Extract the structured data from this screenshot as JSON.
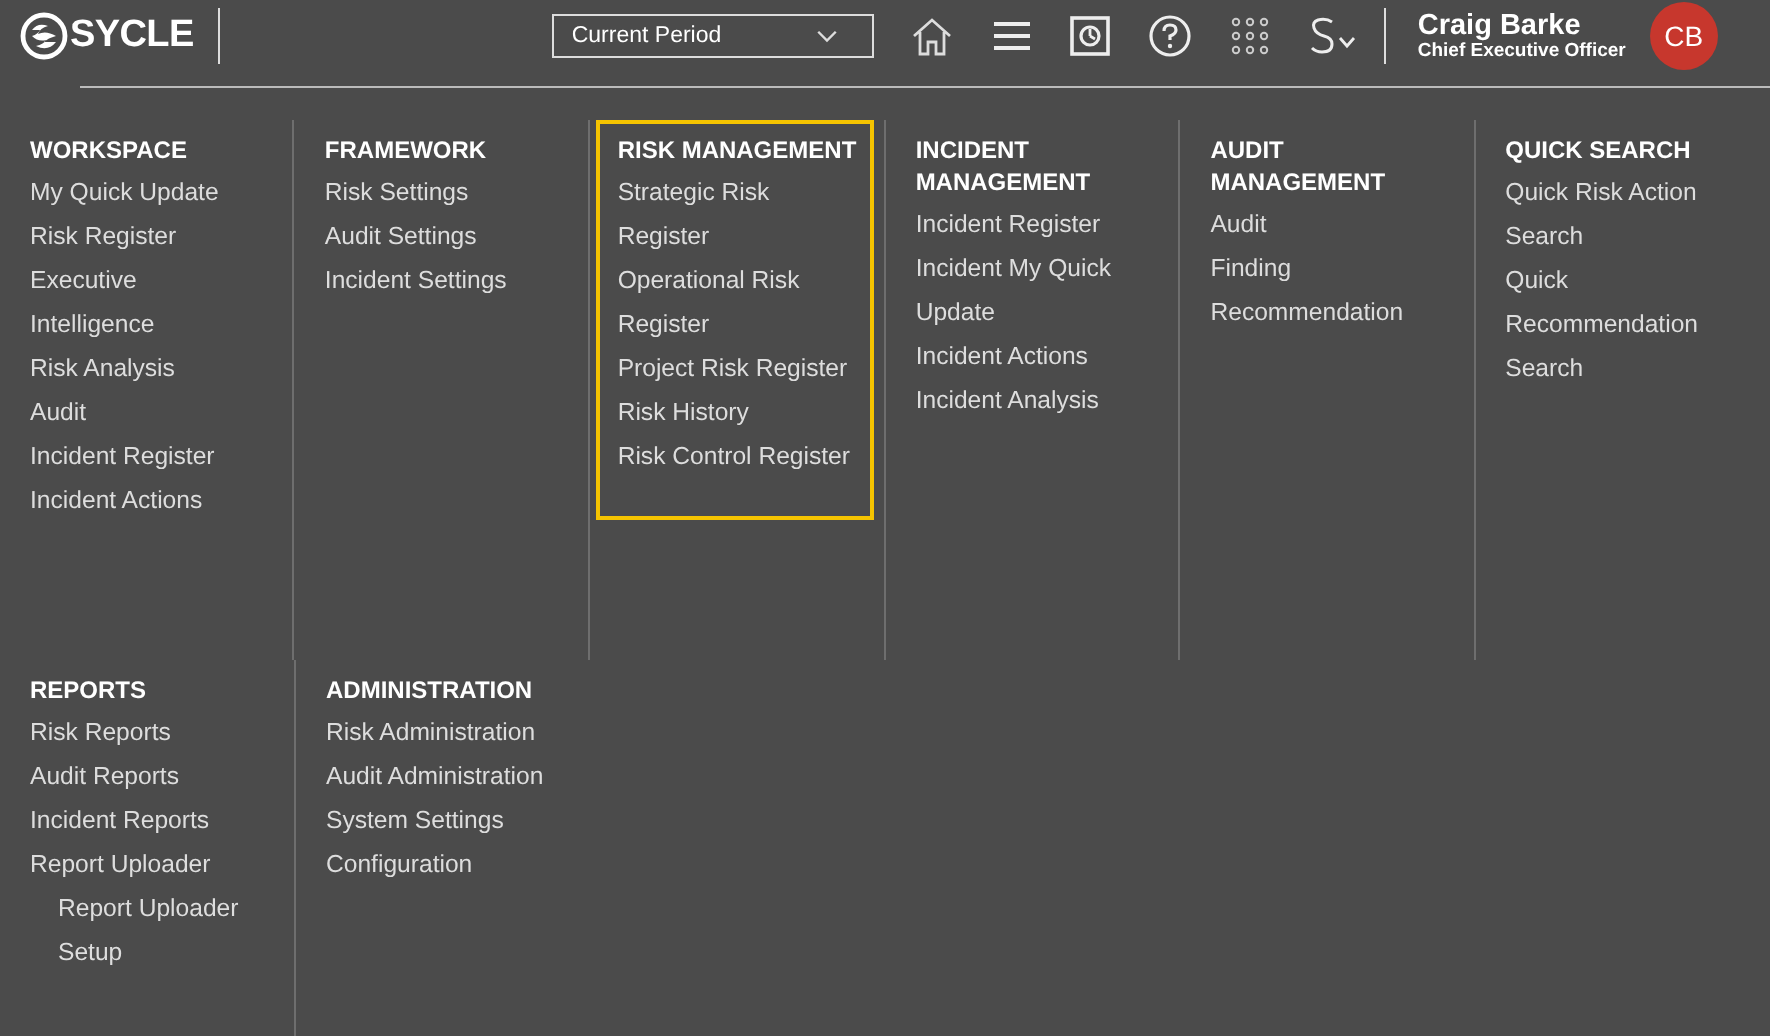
{
  "header": {
    "logo": "SYCLE",
    "period_select": {
      "value": "Current Period"
    },
    "user": {
      "name": "Craig Barke",
      "role": "Chief Executive Officer",
      "initials": "CB"
    }
  },
  "menu_rows": [
    [
      {
        "heading": [
          "WORKSPACE"
        ],
        "highlighted": false,
        "items": [
          {
            "label": "My Quick Update"
          },
          {
            "label": "Risk Register"
          },
          {
            "label": "Executive"
          },
          {
            "label": "Intelligence"
          },
          {
            "label": "Risk Analysis"
          },
          {
            "label": "Audit"
          },
          {
            "label": "Incident Register"
          },
          {
            "label": "Incident Actions"
          }
        ]
      },
      {
        "heading": [
          "FRAMEWORK"
        ],
        "highlighted": false,
        "items": [
          {
            "label": "Risk Settings"
          },
          {
            "label": "Audit Settings"
          },
          {
            "label": "Incident Settings"
          }
        ]
      },
      {
        "heading": [
          "RISK MANAGEMENT"
        ],
        "highlighted": true,
        "items": [
          {
            "label": "Strategic Risk"
          },
          {
            "label": "Register"
          },
          {
            "label": "Operational Risk"
          },
          {
            "label": "Register"
          },
          {
            "label": "Project Risk Register"
          },
          {
            "label": "Risk History"
          },
          {
            "label": "Risk Control Register"
          }
        ]
      },
      {
        "heading": [
          "INCIDENT",
          "MANAGEMENT"
        ],
        "highlighted": false,
        "items": [
          {
            "label": "Incident Register"
          },
          {
            "label": "Incident My Quick"
          },
          {
            "label": "Update"
          },
          {
            "label": "Incident Actions"
          },
          {
            "label": "Incident Analysis"
          }
        ]
      },
      {
        "heading": [
          "AUDIT",
          "MANAGEMENT"
        ],
        "highlighted": false,
        "items": [
          {
            "label": "Audit"
          },
          {
            "label": "Finding"
          },
          {
            "label": "Recommendation"
          }
        ]
      },
      {
        "heading": [
          "QUICK SEARCH"
        ],
        "highlighted": false,
        "items": [
          {
            "label": "Quick Risk Action"
          },
          {
            "label": "Search"
          },
          {
            "label": "Quick"
          },
          {
            "label": "Recommendation"
          },
          {
            "label": "Search"
          }
        ]
      }
    ],
    [
      {
        "heading": [
          "REPORTS"
        ],
        "highlighted": false,
        "items": [
          {
            "label": "Risk Reports"
          },
          {
            "label": "Audit Reports"
          },
          {
            "label": "Incident Reports"
          },
          {
            "label": "Report Uploader",
            "children": [
              {
                "label": "Report Uploader"
              },
              {
                "label": "Setup"
              }
            ]
          }
        ]
      },
      {
        "heading": [
          "ADMINISTRATION"
        ],
        "highlighted": false,
        "items": [
          {
            "label": "Risk Administration"
          },
          {
            "label": "Audit Administration"
          },
          {
            "label": "System Settings"
          },
          {
            "label": "Configuration"
          }
        ]
      }
    ]
  ]
}
